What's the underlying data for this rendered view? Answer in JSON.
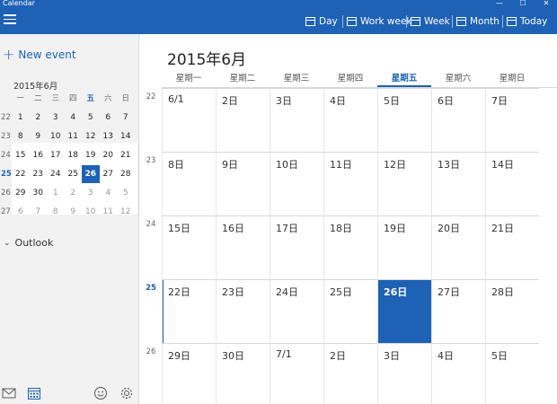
{
  "window": {
    "title": "Calendar",
    "minimize": "—",
    "maximize": "☐",
    "close": "✕"
  },
  "toolbar": {
    "views": [
      {
        "label": "Day"
      },
      {
        "label": "Work week"
      },
      {
        "label": "Week"
      },
      {
        "label": "Month"
      },
      {
        "label": "Today"
      }
    ]
  },
  "sidebar": {
    "new_event": "New event",
    "mini_title": "2015年6月",
    "weekday_headers": [
      "一",
      "二",
      "三",
      "四",
      "五",
      "六",
      "日"
    ],
    "weeks": [
      {
        "num": "22",
        "days": [
          "1",
          "2",
          "3",
          "4",
          "5",
          "6",
          "7"
        ]
      },
      {
        "num": "23",
        "days": [
          "8",
          "9",
          "10",
          "11",
          "12",
          "13",
          "14"
        ]
      },
      {
        "num": "24",
        "days": [
          "15",
          "16",
          "17",
          "18",
          "19",
          "20",
          "21"
        ]
      },
      {
        "num": "25",
        "days": [
          "22",
          "23",
          "24",
          "25",
          "26",
          "27",
          "28"
        ]
      },
      {
        "num": "26",
        "days": [
          "29",
          "30",
          "1",
          "2",
          "3",
          "4",
          "5"
        ]
      },
      {
        "num": "27",
        "days": [
          "6",
          "7",
          "8",
          "9",
          "10",
          "11",
          "12"
        ]
      }
    ],
    "outlook": "Outlook"
  },
  "main": {
    "month_title": "2015年6月",
    "weekday_headers": [
      "星期一",
      "星期二",
      "星期三",
      "星期四",
      "星期五",
      "星期六",
      "星期日"
    ],
    "weeks": [
      {
        "num": "22",
        "days": [
          "6/1",
          "2日",
          "3日",
          "4日",
          "5日",
          "6日",
          "7日"
        ]
      },
      {
        "num": "23",
        "days": [
          "8日",
          "9日",
          "10日",
          "11日",
          "12日",
          "13日",
          "14日"
        ]
      },
      {
        "num": "24",
        "days": [
          "15日",
          "16日",
          "17日",
          "18日",
          "19日",
          "20日",
          "21日"
        ]
      },
      {
        "num": "25",
        "days": [
          "22日",
          "23日",
          "24日",
          "25日",
          "26日",
          "27日",
          "28日"
        ]
      },
      {
        "num": "26",
        "days": [
          "29日",
          "30日",
          "7/1",
          "2日",
          "3日",
          "4日",
          "5日"
        ]
      }
    ]
  },
  "colors": {
    "accent": "#1e62b5",
    "sidebar_bg": "#f2f2f2"
  }
}
